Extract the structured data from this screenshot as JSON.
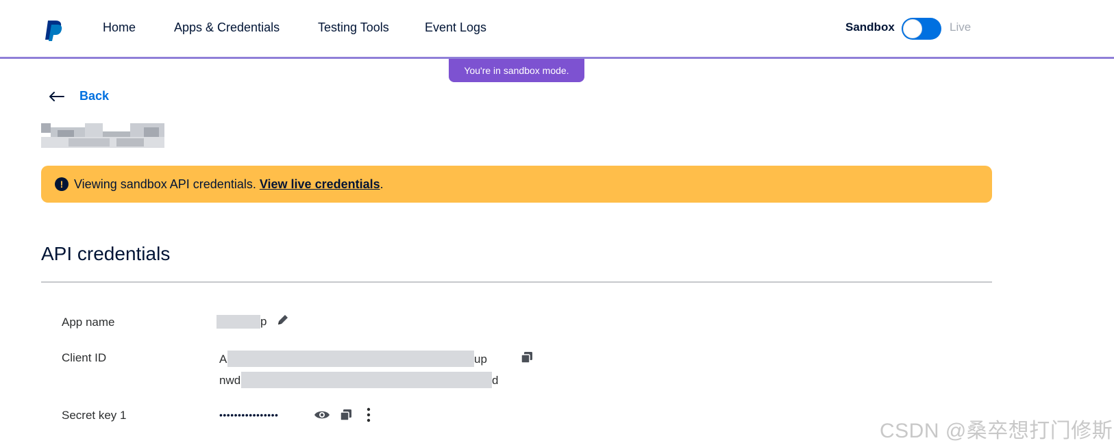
{
  "header": {
    "logo_icon": "paypal-logo-icon",
    "nav": [
      {
        "label": "Home"
      },
      {
        "label": "Apps & Credentials"
      },
      {
        "label": "Testing Tools"
      },
      {
        "label": "Event Logs"
      }
    ],
    "env_sandbox_label": "Sandbox",
    "env_live_label": "Live",
    "toggle_state": "sandbox"
  },
  "banner": {
    "text": "You're in sandbox mode."
  },
  "back": {
    "label": "Back"
  },
  "alert": {
    "text": "Viewing sandbox API credentials.",
    "link": "View live credentials",
    "suffix": "."
  },
  "section": {
    "title": "API credentials",
    "app_name_label": "App name",
    "app_name_visible_tail": "p",
    "client_id_label": "Client ID",
    "client_id_line1_start": "A",
    "client_id_line1_end": "up",
    "client_id_line2_start": "nwd",
    "client_id_line2_end": "d",
    "secret_label": "Secret key 1",
    "secret_masked": "••••••••••••••••"
  },
  "watermark": {
    "text": "CSDN @桑卒想打门修斯"
  },
  "colors": {
    "accent_blue": "#0070e0",
    "sandbox_purple": "#7d52d1",
    "alert_yellow": "#ffbe4a",
    "text_dark": "#001435"
  }
}
